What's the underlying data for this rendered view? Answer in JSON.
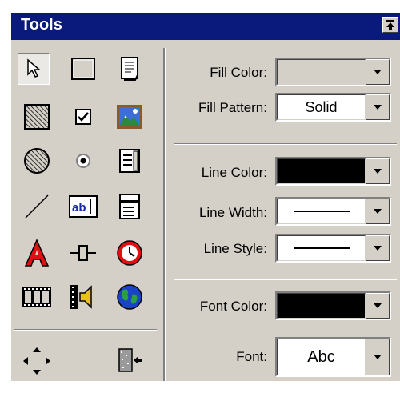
{
  "title": "Tools",
  "fill": {
    "color_label": "Fill Color:",
    "pattern_label": "Fill Pattern:",
    "pattern_value": "Solid"
  },
  "line": {
    "color_label": "Line Color:",
    "width_label": "Line Width:",
    "style_label": "Line Style:"
  },
  "font": {
    "color_label": "Font Color:",
    "font_label": "Font:",
    "font_value": "Abc"
  },
  "tools": [
    "pointer-tool",
    "rectangle-tool",
    "document-tool",
    "hatched-rectangle-tool",
    "checkbox-tool",
    "image-tool",
    "hatched-circle-tool",
    "radio-button-tool",
    "list-tool",
    "line-tool",
    "text-field-tool",
    "combo-box-tool",
    "text-tool",
    "slider-tool",
    "clock-tool",
    "film-tool",
    "sound-tool",
    "globe-tool"
  ],
  "colors": {
    "titlebar": "#0a1a7c",
    "panel": "#d4d0c8",
    "font_color": "#000000",
    "line_color": "#000000"
  }
}
